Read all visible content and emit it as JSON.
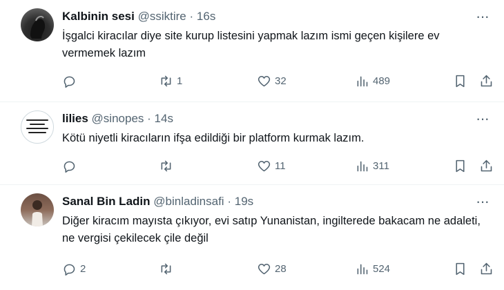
{
  "tweets": [
    {
      "name": "Kalbinin sesi",
      "handle": "@ssiktire",
      "time": "16s",
      "text": "İşgalci kiracılar diye site kurup listesini yapmak lazım ismi geçen kişilere ev vermemek lazım",
      "replies": "",
      "retweets": "1",
      "likes": "32",
      "views": "489"
    },
    {
      "name": "lilies",
      "handle": "@sinopes",
      "time": "14s",
      "text": "Kötü niyetli kiracıların ifşa edildiği bir platform kurmak lazım.",
      "replies": "",
      "retweets": "",
      "likes": "11",
      "views": "311"
    },
    {
      "name": "Sanal Bin Ladin",
      "handle": "@binladinsafi",
      "time": "19s",
      "text": "Diğer kiracım mayısta çıkıyor, evi satıp Yunanistan, ingilterede bakacam ne adaleti, ne vergisi çekilecek çile değil",
      "replies": "2",
      "retweets": "",
      "likes": "28",
      "views": "524"
    }
  ],
  "separator": "·",
  "more_glyph": "···",
  "colors": {
    "text": "#0f1419",
    "muted": "#536471",
    "divider": "#eff3f4"
  },
  "icons": [
    "reply-icon",
    "retweet-icon",
    "heart-icon",
    "views-icon",
    "bookmark-icon",
    "share-icon",
    "more-icon"
  ]
}
